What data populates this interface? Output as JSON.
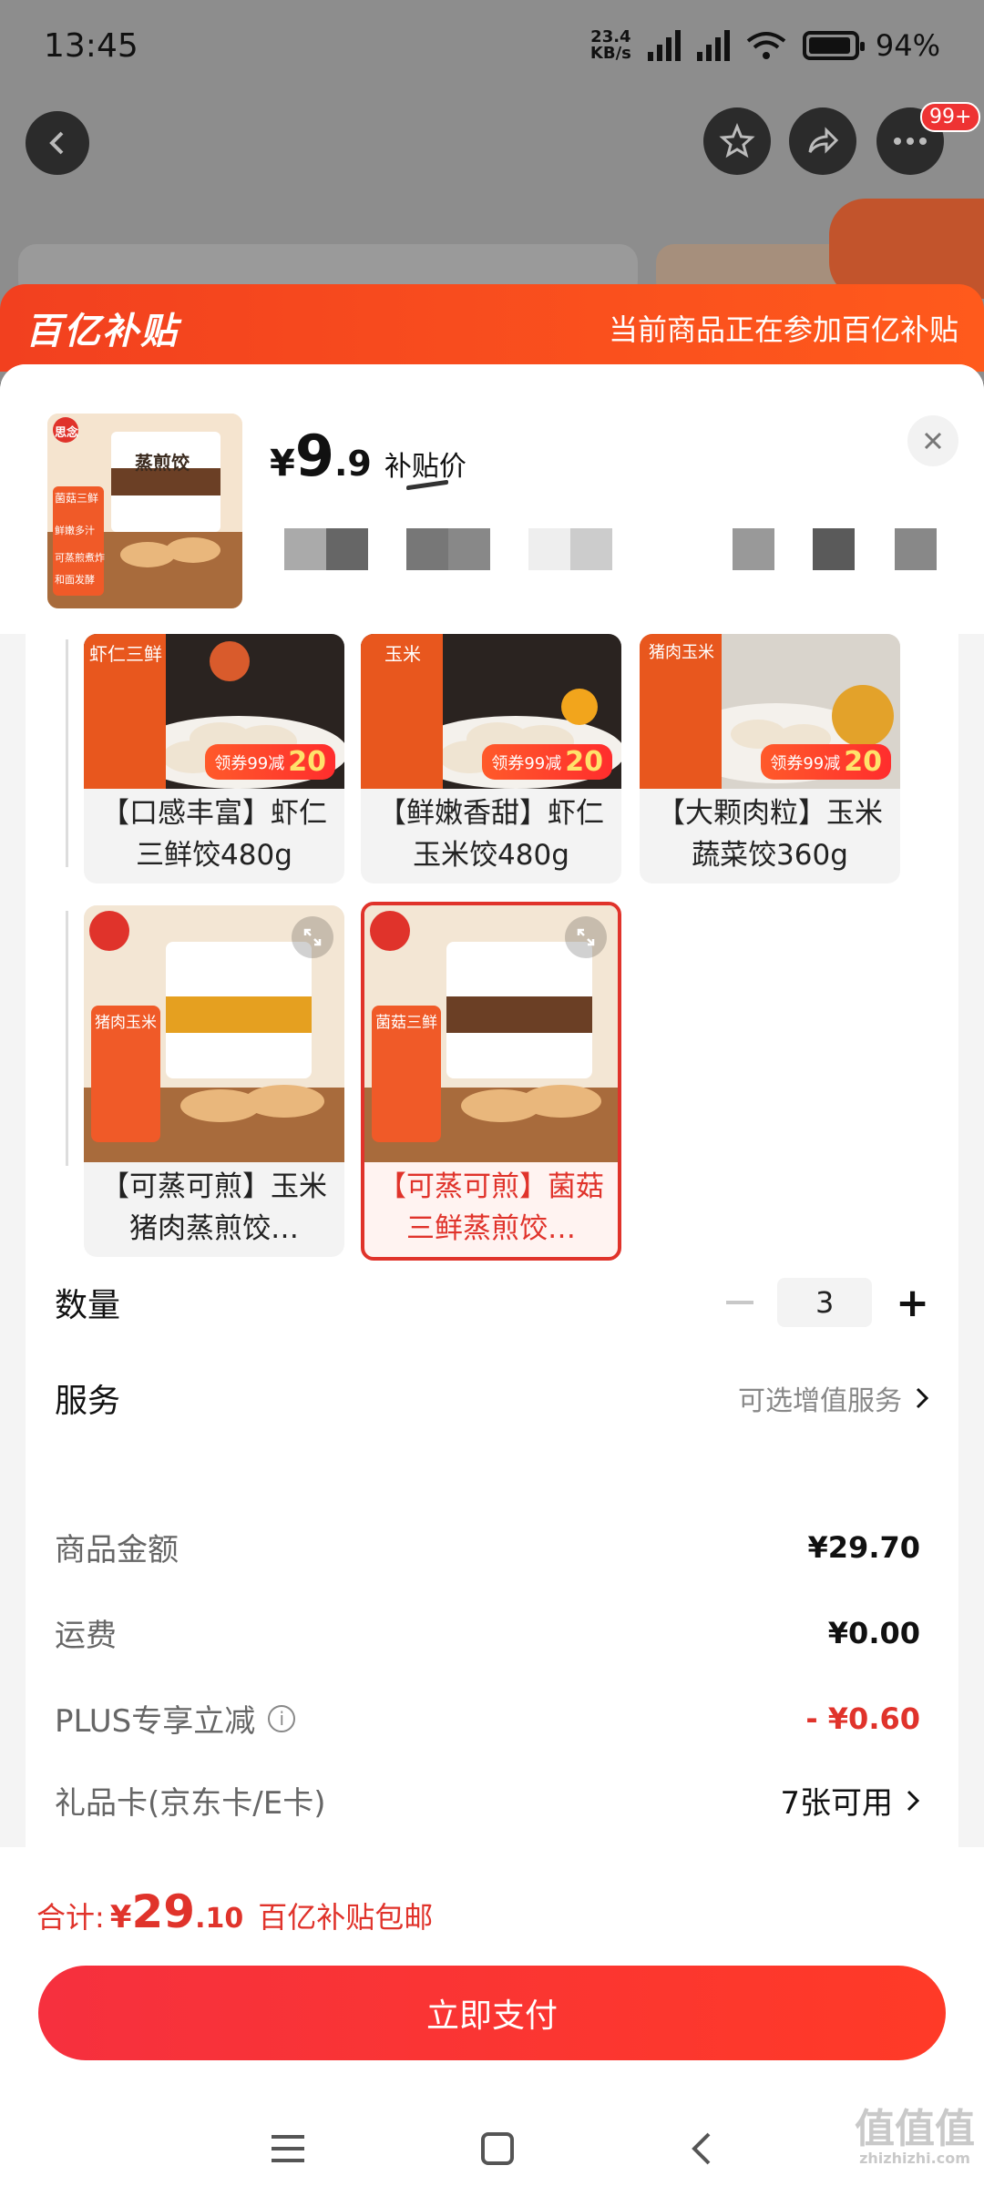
{
  "status_bar": {
    "time": "13:45",
    "net_speed": "23.4",
    "net_unit": "KB/s",
    "battery": "94%"
  },
  "nav": {
    "badge": "99+"
  },
  "sheet": {
    "brand": "百亿补贴",
    "brand_note": "当前商品正在参加百亿补贴"
  },
  "product": {
    "price_symbol": "¥",
    "price_int": "9",
    "price_dec": ".9",
    "price_tag": "补贴价"
  },
  "variants": [
    {
      "label": "【口感丰富】虾仁三鲜饺480g",
      "thumb_tag": "虾仁三鲜",
      "promo": "领券99减",
      "promo_amount": "20",
      "selected": false
    },
    {
      "label": "【鲜嫩香甜】虾仁玉米饺480g",
      "thumb_tag": "玉米",
      "promo": "领券99减",
      "promo_amount": "20",
      "selected": false
    },
    {
      "label": "【大颗肉粒】玉米蔬菜饺360g",
      "thumb_tag": "猪肉玉米",
      "promo": "领券99减",
      "promo_amount": "20",
      "selected": false
    },
    {
      "label": "【可蒸可煎】玉米猪肉蒸煎饺…",
      "thumb_tag": "猪肉玉米",
      "selected": false
    },
    {
      "label": "【可蒸可煎】菌菇三鲜蒸煎饺…",
      "thumb_tag": "菌菇三鲜",
      "selected": true
    }
  ],
  "thumb_text": {
    "brand": "思念",
    "product": "蒸煎饺",
    "tag": "菌菇三鲜",
    "line1": "鲜嫩多汁",
    "line2": "可蒸煎煮炸",
    "line3": "和面发酵"
  },
  "quantity": {
    "label": "数量",
    "value": "3",
    "minus": "−",
    "plus": "+"
  },
  "service": {
    "label": "服务",
    "value": "可选增值服务"
  },
  "summary": {
    "goods_label": "商品金额",
    "goods_value": "¥29.70",
    "shipping_label": "运费",
    "shipping_value": "¥0.00",
    "plus_label": "PLUS专享立减",
    "plus_value": "- ¥0.60",
    "giftcard_label": "礼品卡(京东卡/E卡)",
    "giftcard_value": "7张可用"
  },
  "total": {
    "label": "合计:",
    "symbol": "¥",
    "int": "29",
    "dec": ".10",
    "note": "百亿补贴包邮"
  },
  "pay_button": "立即支付",
  "watermark": {
    "main": "值值值",
    "sub": "zhizhizhi.com"
  },
  "colors": {
    "accent": "#e0332b",
    "brand_orange": "#f2401f"
  }
}
